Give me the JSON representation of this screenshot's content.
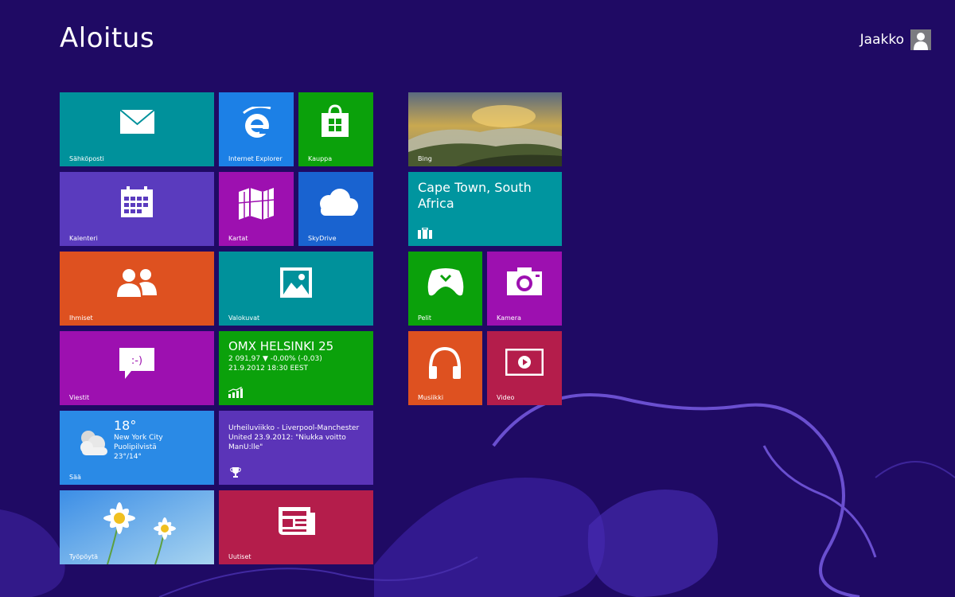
{
  "header": {
    "title": "Aloitus",
    "user_name": "Jaakko"
  },
  "tiles": {
    "mail": {
      "label": "Sähköposti"
    },
    "ie": {
      "label": "Internet Explorer"
    },
    "store": {
      "label": "Kauppa"
    },
    "bing": {
      "label": "Bing"
    },
    "calendar": {
      "label": "Kalenteri"
    },
    "maps": {
      "label": "Kartat"
    },
    "skydrive": {
      "label": "SkyDrive"
    },
    "travel": {
      "headline": "Cape Town, South Africa"
    },
    "people": {
      "label": "Ihmiset"
    },
    "photos": {
      "label": "Valokuvat"
    },
    "games": {
      "label": "Pelit"
    },
    "camera": {
      "label": "Kamera"
    },
    "messaging": {
      "label": "Viestit"
    },
    "finance": {
      "title": "OMX HELSINKI 25",
      "quote": "2 091,97 ▼ -0,00% (-0,03)",
      "timestamp": "21.9.2012 18:30 EEST"
    },
    "music": {
      "label": "Musiikki"
    },
    "video": {
      "label": "Video"
    },
    "weather": {
      "label": "Sää",
      "temperature": "18°",
      "city": "New York City",
      "condition": "Puolipilvistä",
      "range": "23°/14°"
    },
    "sports": {
      "text": "Urheiluviikko - Liverpool-Manchester United 23.9.2012: \"Niukka voitto ManU:lle\""
    },
    "desktop": {
      "label": "Työpöytä"
    },
    "news": {
      "label": "Uutiset"
    }
  },
  "colors": {
    "background": "#1f0a64",
    "accent_swirl": "#6a4fd0"
  }
}
